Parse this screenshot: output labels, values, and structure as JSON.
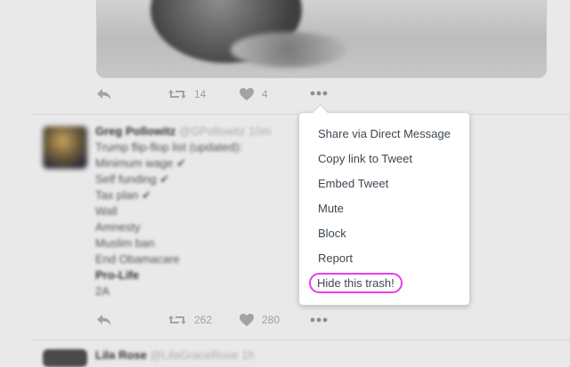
{
  "tweet1": {
    "retweet_count": "14",
    "like_count": "4"
  },
  "tweet2": {
    "author_name": "Greg Pollowitz",
    "author_handle": "@GPollowitz",
    "time": "10m",
    "lines": [
      "Trump flip-flop list (updated):",
      "Minimum wage ✔",
      "Self funding ✔",
      "Tax plan ✔",
      "Wall",
      "Amnesty",
      "Muslim ban",
      "End Obamacare",
      "Pro-Life",
      "2A"
    ],
    "retweet_count": "262",
    "like_count": "280"
  },
  "tweet3": {
    "author_name": "Lila Rose",
    "author_handle": "@LilaGraceRose",
    "time": "1h"
  },
  "menu": {
    "items": [
      "Share via Direct Message",
      "Copy link to Tweet",
      "Embed Tweet",
      "Mute",
      "Block",
      "Report",
      "Hide this trash!"
    ]
  },
  "colors": {
    "highlight_outline": "#e83ee8",
    "background": "#e9e9e9",
    "menu_text": "#3d4750"
  },
  "icons": [
    "reply-icon",
    "retweet-icon",
    "like-icon",
    "more-icon"
  ]
}
